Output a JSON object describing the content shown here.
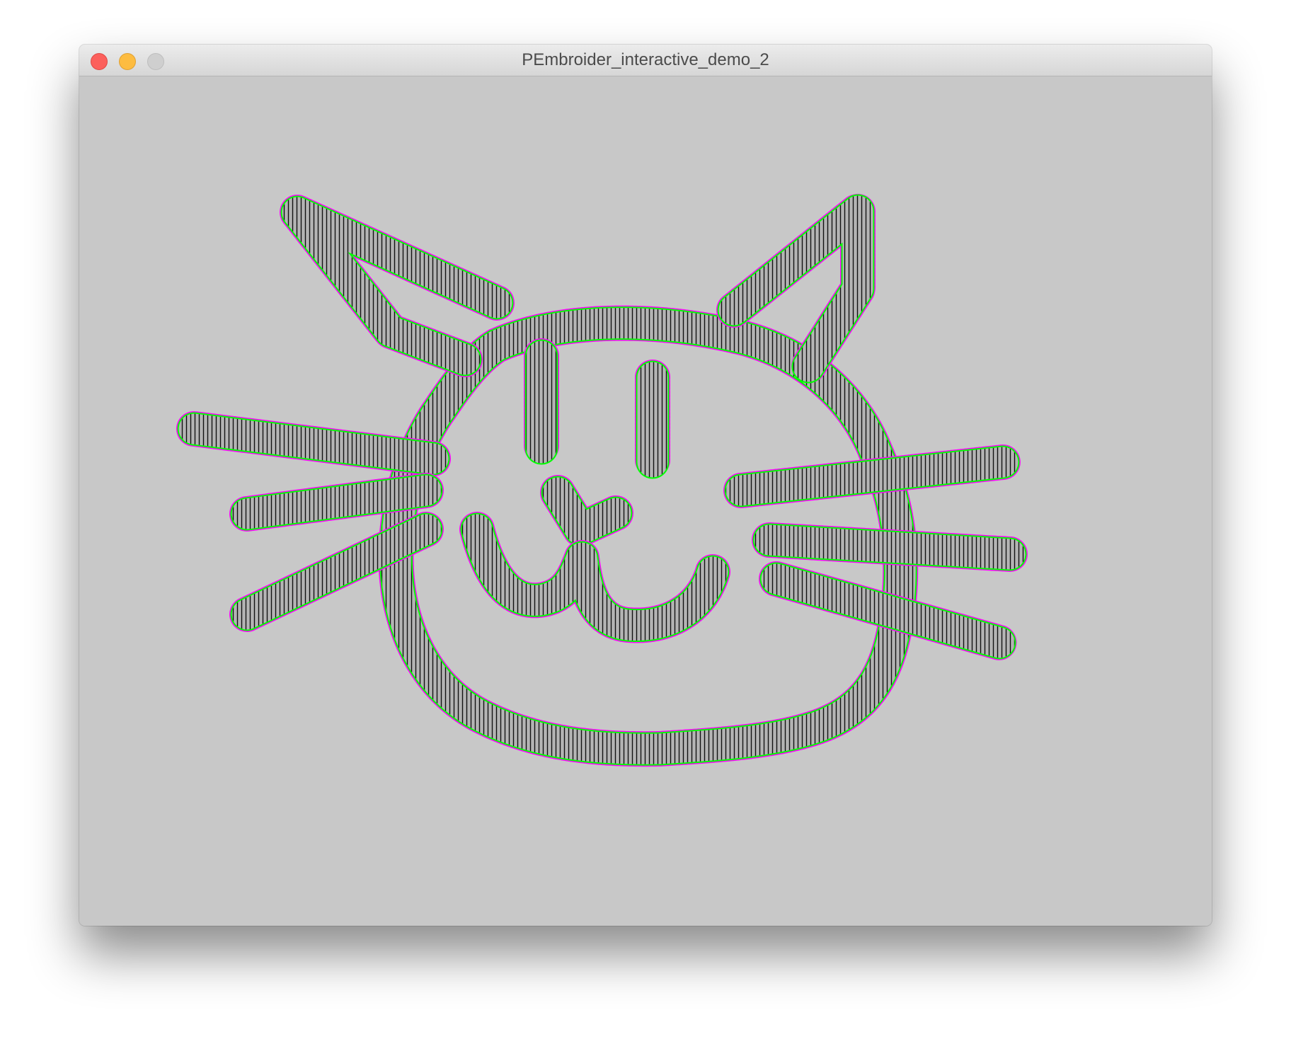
{
  "window": {
    "title": "PEmbroider_interactive_demo_2"
  },
  "canvas": {
    "background": "#c8c8c8",
    "stitch_color": "#000000",
    "fill_color": "#b4b4b4",
    "inner_outline_color": "#00ff00",
    "outer_outline_color": "#ff00ff",
    "drawing": "cat face with ears, eyes, nose, smile and whiskers"
  },
  "icons": {
    "close": "close-button",
    "minimize": "minimize-button",
    "zoom": "zoom-button"
  }
}
